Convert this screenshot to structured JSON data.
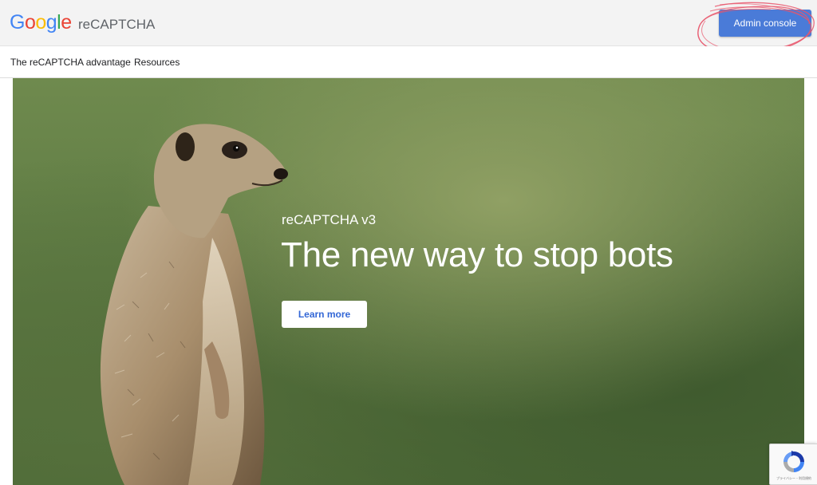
{
  "header": {
    "logo_letters": [
      {
        "char": "G",
        "color": "#4285F4"
      },
      {
        "char": "o",
        "color": "#EA4335"
      },
      {
        "char": "o",
        "color": "#FBBC05"
      },
      {
        "char": "g",
        "color": "#4285F4"
      },
      {
        "char": "l",
        "color": "#34A853"
      },
      {
        "char": "e",
        "color": "#EA4335"
      }
    ],
    "product_name": "reCAPTCHA",
    "admin_button_label": "Admin console",
    "accent_color": "#4a7bd8"
  },
  "nav": {
    "items": [
      {
        "label": "The reCAPTCHA advantage"
      },
      {
        "label": "Resources"
      }
    ]
  },
  "hero": {
    "subtitle": "reCAPTCHA v3",
    "title": "The new way to stop bots",
    "cta_label": "Learn more",
    "image_subject": "meerkat"
  },
  "badge": {
    "icon": "recaptcha-logo-icon",
    "text": "プライバシー・利用規約"
  }
}
